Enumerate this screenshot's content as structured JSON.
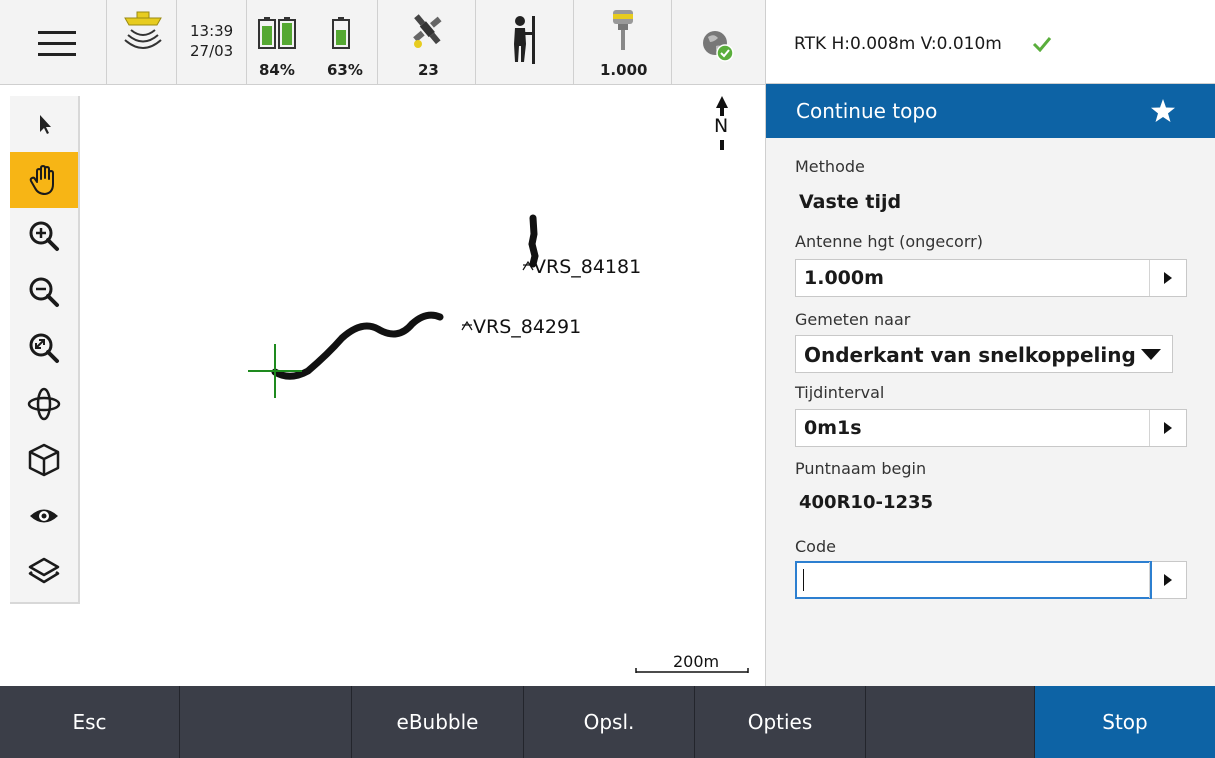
{
  "status_bar": {
    "time": "13:39",
    "date": "27/03",
    "battery_1": "84%",
    "battery_2": "63%",
    "satellites": "23",
    "antenna_height": "1.000"
  },
  "rtk": {
    "text": "RTK H:0.008m V:0.010m",
    "ok_color": "#5aae3c"
  },
  "toolbar": {
    "tools": [
      {
        "icon": "pointer-arrow-icon",
        "active": false
      },
      {
        "icon": "pan-hand-icon",
        "active": true
      },
      {
        "icon": "zoom-in-icon",
        "active": false
      },
      {
        "icon": "zoom-out-icon",
        "active": false
      },
      {
        "icon": "zoom-extents-icon",
        "active": false
      },
      {
        "icon": "orbit-icon",
        "active": false
      },
      {
        "icon": "cube-view-icon",
        "active": false
      },
      {
        "icon": "eye-icon",
        "active": false
      },
      {
        "icon": "layers-icon",
        "active": false
      }
    ]
  },
  "map": {
    "north_label": "N",
    "points": [
      "VRS_84181",
      "VRS_84291"
    ],
    "scale_label": "200m"
  },
  "panel": {
    "title": "Continue topo",
    "method_label": "Methode",
    "method_value": "Vaste tijd",
    "antenna_label": "Antenne hgt (ongecorr)",
    "antenna_value": "1.000m",
    "measured_to_label": "Gemeten naar",
    "measured_to_value": "Onderkant van snelkoppeling",
    "interval_label": "Tijdinterval",
    "interval_value": "0m1s",
    "start_point_label": "Puntnaam begin",
    "start_point_value": "400R10-1235",
    "code_label": "Code",
    "code_value": ""
  },
  "bottom_bar": {
    "esc": "Esc",
    "empty_1": "",
    "ebubble": "eBubble",
    "save": "Opsl.",
    "options": "Opties",
    "empty_2": "",
    "stop": "Stop"
  },
  "colors": {
    "accent_blue": "#0d63a5",
    "active_tool": "#f7b515",
    "bottom_bar": "#3b3e48"
  }
}
